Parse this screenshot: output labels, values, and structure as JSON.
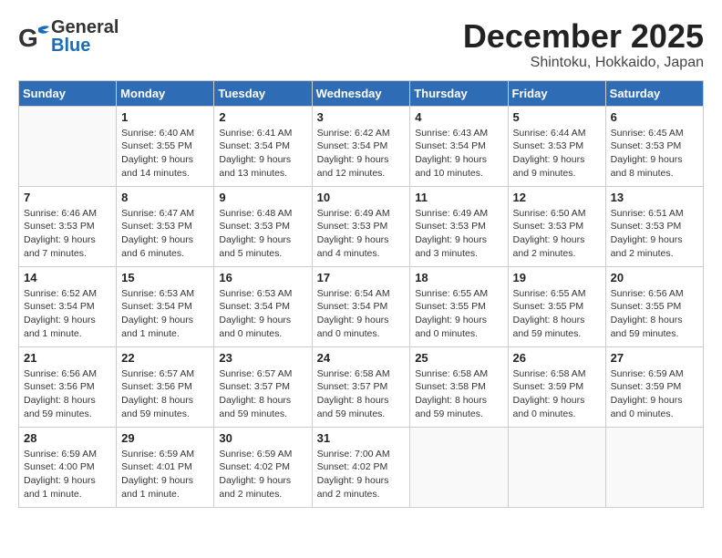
{
  "header": {
    "logo_general": "General",
    "logo_blue": "Blue",
    "month_title": "December 2025",
    "location": "Shintoku, Hokkaido, Japan"
  },
  "days_of_week": [
    "Sunday",
    "Monday",
    "Tuesday",
    "Wednesday",
    "Thursday",
    "Friday",
    "Saturday"
  ],
  "weeks": [
    [
      {
        "day": "",
        "info": ""
      },
      {
        "day": "1",
        "info": "Sunrise: 6:40 AM\nSunset: 3:55 PM\nDaylight: 9 hours\nand 14 minutes."
      },
      {
        "day": "2",
        "info": "Sunrise: 6:41 AM\nSunset: 3:54 PM\nDaylight: 9 hours\nand 13 minutes."
      },
      {
        "day": "3",
        "info": "Sunrise: 6:42 AM\nSunset: 3:54 PM\nDaylight: 9 hours\nand 12 minutes."
      },
      {
        "day": "4",
        "info": "Sunrise: 6:43 AM\nSunset: 3:54 PM\nDaylight: 9 hours\nand 10 minutes."
      },
      {
        "day": "5",
        "info": "Sunrise: 6:44 AM\nSunset: 3:53 PM\nDaylight: 9 hours\nand 9 minutes."
      },
      {
        "day": "6",
        "info": "Sunrise: 6:45 AM\nSunset: 3:53 PM\nDaylight: 9 hours\nand 8 minutes."
      }
    ],
    [
      {
        "day": "7",
        "info": "Sunrise: 6:46 AM\nSunset: 3:53 PM\nDaylight: 9 hours\nand 7 minutes."
      },
      {
        "day": "8",
        "info": "Sunrise: 6:47 AM\nSunset: 3:53 PM\nDaylight: 9 hours\nand 6 minutes."
      },
      {
        "day": "9",
        "info": "Sunrise: 6:48 AM\nSunset: 3:53 PM\nDaylight: 9 hours\nand 5 minutes."
      },
      {
        "day": "10",
        "info": "Sunrise: 6:49 AM\nSunset: 3:53 PM\nDaylight: 9 hours\nand 4 minutes."
      },
      {
        "day": "11",
        "info": "Sunrise: 6:49 AM\nSunset: 3:53 PM\nDaylight: 9 hours\nand 3 minutes."
      },
      {
        "day": "12",
        "info": "Sunrise: 6:50 AM\nSunset: 3:53 PM\nDaylight: 9 hours\nand 2 minutes."
      },
      {
        "day": "13",
        "info": "Sunrise: 6:51 AM\nSunset: 3:53 PM\nDaylight: 9 hours\nand 2 minutes."
      }
    ],
    [
      {
        "day": "14",
        "info": "Sunrise: 6:52 AM\nSunset: 3:54 PM\nDaylight: 9 hours\nand 1 minute."
      },
      {
        "day": "15",
        "info": "Sunrise: 6:53 AM\nSunset: 3:54 PM\nDaylight: 9 hours\nand 1 minute."
      },
      {
        "day": "16",
        "info": "Sunrise: 6:53 AM\nSunset: 3:54 PM\nDaylight: 9 hours\nand 0 minutes."
      },
      {
        "day": "17",
        "info": "Sunrise: 6:54 AM\nSunset: 3:54 PM\nDaylight: 9 hours\nand 0 minutes."
      },
      {
        "day": "18",
        "info": "Sunrise: 6:55 AM\nSunset: 3:55 PM\nDaylight: 9 hours\nand 0 minutes."
      },
      {
        "day": "19",
        "info": "Sunrise: 6:55 AM\nSunset: 3:55 PM\nDaylight: 8 hours\nand 59 minutes."
      },
      {
        "day": "20",
        "info": "Sunrise: 6:56 AM\nSunset: 3:55 PM\nDaylight: 8 hours\nand 59 minutes."
      }
    ],
    [
      {
        "day": "21",
        "info": "Sunrise: 6:56 AM\nSunset: 3:56 PM\nDaylight: 8 hours\nand 59 minutes."
      },
      {
        "day": "22",
        "info": "Sunrise: 6:57 AM\nSunset: 3:56 PM\nDaylight: 8 hours\nand 59 minutes."
      },
      {
        "day": "23",
        "info": "Sunrise: 6:57 AM\nSunset: 3:57 PM\nDaylight: 8 hours\nand 59 minutes."
      },
      {
        "day": "24",
        "info": "Sunrise: 6:58 AM\nSunset: 3:57 PM\nDaylight: 8 hours\nand 59 minutes."
      },
      {
        "day": "25",
        "info": "Sunrise: 6:58 AM\nSunset: 3:58 PM\nDaylight: 8 hours\nand 59 minutes."
      },
      {
        "day": "26",
        "info": "Sunrise: 6:58 AM\nSunset: 3:59 PM\nDaylight: 9 hours\nand 0 minutes."
      },
      {
        "day": "27",
        "info": "Sunrise: 6:59 AM\nSunset: 3:59 PM\nDaylight: 9 hours\nand 0 minutes."
      }
    ],
    [
      {
        "day": "28",
        "info": "Sunrise: 6:59 AM\nSunset: 4:00 PM\nDaylight: 9 hours\nand 1 minute."
      },
      {
        "day": "29",
        "info": "Sunrise: 6:59 AM\nSunset: 4:01 PM\nDaylight: 9 hours\nand 1 minute."
      },
      {
        "day": "30",
        "info": "Sunrise: 6:59 AM\nSunset: 4:02 PM\nDaylight: 9 hours\nand 2 minutes."
      },
      {
        "day": "31",
        "info": "Sunrise: 7:00 AM\nSunset: 4:02 PM\nDaylight: 9 hours\nand 2 minutes."
      },
      {
        "day": "",
        "info": ""
      },
      {
        "day": "",
        "info": ""
      },
      {
        "day": "",
        "info": ""
      }
    ]
  ]
}
